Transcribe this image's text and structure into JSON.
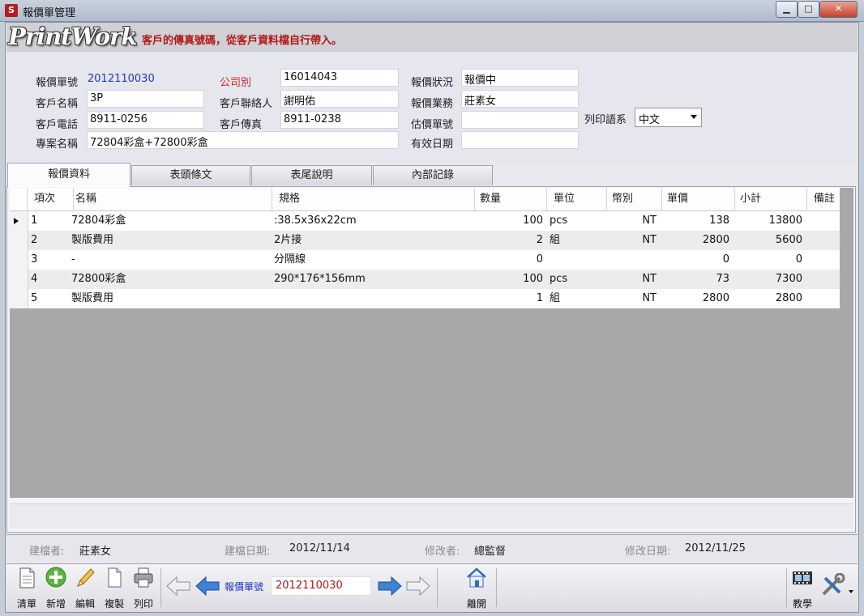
{
  "window": {
    "title": "報價單管理",
    "icon_letter": "S",
    "buttons": {
      "minimize": "▁",
      "maximize": "□",
      "close": "✕"
    }
  },
  "banner": {
    "logo": "PrintWork",
    "message": "客戶的傳真號碼，從客戶資料檔自行帶入。"
  },
  "form": {
    "quote_no": {
      "label": "報價單號",
      "value": "2012110030"
    },
    "company": {
      "label": "公司別",
      "value": "16014043"
    },
    "status": {
      "label": "報價狀況",
      "value": "報價中"
    },
    "customer_name": {
      "label": "客戶名稱",
      "value": "3P"
    },
    "contact": {
      "label": "客戶聯絡人",
      "value": "謝明佑"
    },
    "sales": {
      "label": "報價業務",
      "value": "莊素女"
    },
    "phone": {
      "label": "客戶電話",
      "value": "8911-0256"
    },
    "fax": {
      "label": "客戶傳真",
      "value": "8911-0238"
    },
    "estimate_no": {
      "label": "估價單號",
      "value": ""
    },
    "print_lang": {
      "label": "列印語系",
      "value": "中文"
    },
    "project": {
      "label": "專案名稱",
      "value": "72804彩盒+72800彩盒"
    },
    "valid_date": {
      "label": "有效日期",
      "value": ""
    }
  },
  "tabs": [
    {
      "label": "報價資料",
      "active": true
    },
    {
      "label": "表頭條文",
      "active": false
    },
    {
      "label": "表尾說明",
      "active": false
    },
    {
      "label": "內部記錄",
      "active": false
    }
  ],
  "grid": {
    "columns": [
      "項次",
      "名稱",
      "規格",
      "數量",
      "單位",
      "幣別",
      "單價",
      "小計",
      "備註"
    ],
    "rows": [
      {
        "no": "1",
        "name": "72804彩盒",
        "spec": ":38.5x36x22cm",
        "qty": "100",
        "unit": "pcs",
        "currency": "NT",
        "price": "138",
        "subtotal": "13800",
        "note": ""
      },
      {
        "no": "2",
        "name": "製版費用",
        "spec": "2片接",
        "qty": "2",
        "unit": "組",
        "currency": "NT",
        "price": "2800",
        "subtotal": "5600",
        "note": ""
      },
      {
        "no": "3",
        "name": "-",
        "spec": "分隔線",
        "qty": "0",
        "unit": "",
        "currency": "",
        "price": "0",
        "subtotal": "0",
        "note": ""
      },
      {
        "no": "4",
        "name": "72800彩盒",
        "spec": "290*176*156mm",
        "qty": "100",
        "unit": "pcs",
        "currency": "NT",
        "price": "73",
        "subtotal": "7300",
        "note": ""
      },
      {
        "no": "5",
        "name": "製版費用",
        "spec": "",
        "qty": "1",
        "unit": "組",
        "currency": "NT",
        "price": "2800",
        "subtotal": "2800",
        "note": ""
      }
    ]
  },
  "info": {
    "creator_label": "建檔者:",
    "creator": "莊素女",
    "created_label": "建檔日期:",
    "created": "2012/11/14",
    "modifier_label": "修改者:",
    "modifier": "總監督",
    "modified_label": "修改日期:",
    "modified": "2012/11/25"
  },
  "toolbar": {
    "list": "清單",
    "add": "新增",
    "edit": "編輯",
    "copy": "複製",
    "print": "列印",
    "nav_label": "報價單號",
    "nav_value": "2012110030",
    "exit": "離開",
    "tutorial": "教學"
  }
}
